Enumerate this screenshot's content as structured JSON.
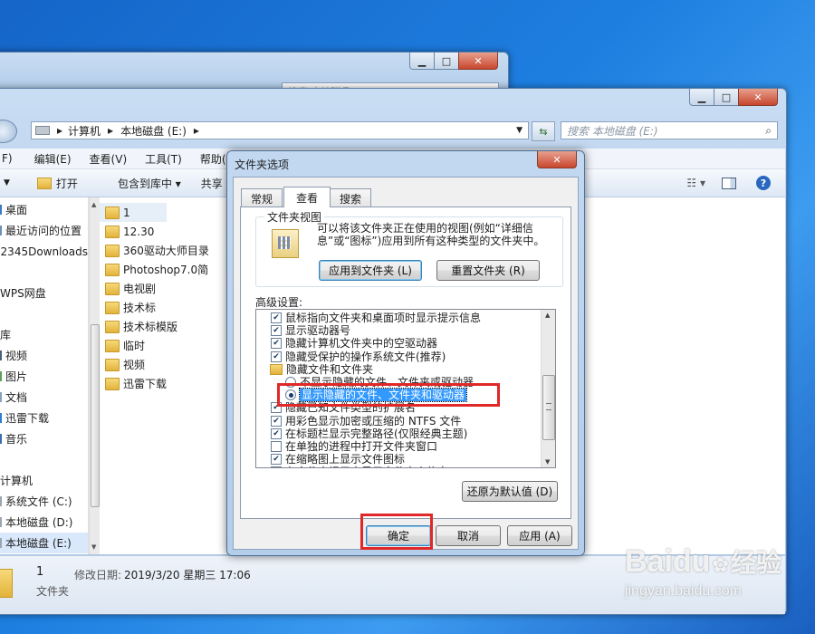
{
  "back_window": {
    "search_placeholder": "搜索 本地磁盘 (E:)"
  },
  "explorer": {
    "address": {
      "computer": "计算机",
      "drive": "本地磁盘 (E:)"
    },
    "search_placeholder": "搜索 本地磁盘 (E:)",
    "menu": [
      "F)",
      "编辑(E)",
      "查看(V)",
      "工具(T)",
      "帮助(H)"
    ],
    "toolbar": {
      "open": "打开",
      "include_library": "包含到库中 ▾",
      "share": "共享"
    },
    "nav": [
      {
        "label": "桌面",
        "icon": "desktop-icon"
      },
      {
        "label": "最近访问的位置",
        "icon": "recent-places-icon"
      },
      {
        "label": "2345Downloads",
        "icon": "folder-icon"
      },
      {
        "label": "",
        "icon": ""
      },
      {
        "label": "WPS网盘",
        "icon": "cloud-icon"
      },
      {
        "label": "",
        "icon": ""
      },
      {
        "label": "库",
        "icon": "library-icon"
      },
      {
        "label": "视频",
        "icon": "video-icon"
      },
      {
        "label": "图片",
        "icon": "picture-icon"
      },
      {
        "label": "文档",
        "icon": "document-icon"
      },
      {
        "label": "迅雷下载",
        "icon": "download-icon"
      },
      {
        "label": "音乐",
        "icon": "music-icon"
      },
      {
        "label": "",
        "icon": ""
      },
      {
        "label": "计算机",
        "icon": "computer-icon"
      },
      {
        "label": "系统文件 (C:)",
        "icon": "drive-icon"
      },
      {
        "label": "本地磁盘 (D:)",
        "icon": "drive-icon"
      },
      {
        "label": "本地磁盘 (E:)",
        "icon": "drive-icon"
      }
    ],
    "files": [
      "1",
      "12.30",
      "360驱动大师目录",
      "Photoshop7.0简",
      "电视剧",
      "技术标",
      "技术标模版",
      "临时",
      "视频",
      "迅雷下载"
    ],
    "status": {
      "name": "1",
      "modified_label": "修改日期:",
      "modified_value": "2019/3/20 星期三 17:06",
      "type": "文件夹"
    }
  },
  "dialog": {
    "title": "文件夹选项",
    "tabs": [
      "常规",
      "查看",
      "搜索"
    ],
    "active_tab": "查看",
    "folder_views": {
      "group_label": "文件夹视图",
      "description": "可以将该文件夹正在使用的视图(例如“详细信息”或“图标”)应用到所有这种类型的文件夹中。",
      "apply_button": "应用到文件夹 (L)",
      "reset_button": "重置文件夹 (R)"
    },
    "advanced_label": "高级设置:",
    "advanced_items": [
      {
        "kind": "checkbox",
        "checked": true,
        "label": "鼠标指向文件夹和桌面项时显示提示信息"
      },
      {
        "kind": "checkbox",
        "checked": true,
        "label": "显示驱动器号"
      },
      {
        "kind": "checkbox",
        "checked": true,
        "label": "隐藏计算机文件夹中的空驱动器"
      },
      {
        "kind": "checkbox",
        "checked": true,
        "label": "隐藏受保护的操作系统文件(推荐)"
      },
      {
        "kind": "folder",
        "checked": false,
        "label": "隐藏文件和文件夹"
      },
      {
        "kind": "radio",
        "checked": false,
        "label": "不显示隐藏的文件、文件夹或驱动器"
      },
      {
        "kind": "radio",
        "checked": true,
        "label": "显示隐藏的文件、文件夹和驱动器"
      },
      {
        "kind": "checkbox",
        "checked": true,
        "label": "隐藏已知文件类型的扩展名"
      },
      {
        "kind": "checkbox",
        "checked": true,
        "label": "用彩色显示加密或压缩的 NTFS 文件"
      },
      {
        "kind": "checkbox",
        "checked": true,
        "label": "在标题栏显示完整路径(仅限经典主题)"
      },
      {
        "kind": "checkbox",
        "checked": false,
        "label": "在单独的进程中打开文件夹窗口"
      },
      {
        "kind": "checkbox",
        "checked": true,
        "label": "在缩略图上显示文件图标"
      },
      {
        "kind": "checkbox",
        "checked": true,
        "label": "在文件夹提示中显示文件大小信息"
      }
    ],
    "restore_button": "还原为默认值 (D)",
    "ok_button": "确定",
    "cancel_button": "取消",
    "apply_button": "应用 (A)"
  },
  "watermark": {
    "brand": "Baidu",
    "suffix": "经验",
    "url": "jingyan.baidu.com"
  },
  "colors": {
    "highlight": "#3399ff",
    "annotation": "#e02828"
  }
}
